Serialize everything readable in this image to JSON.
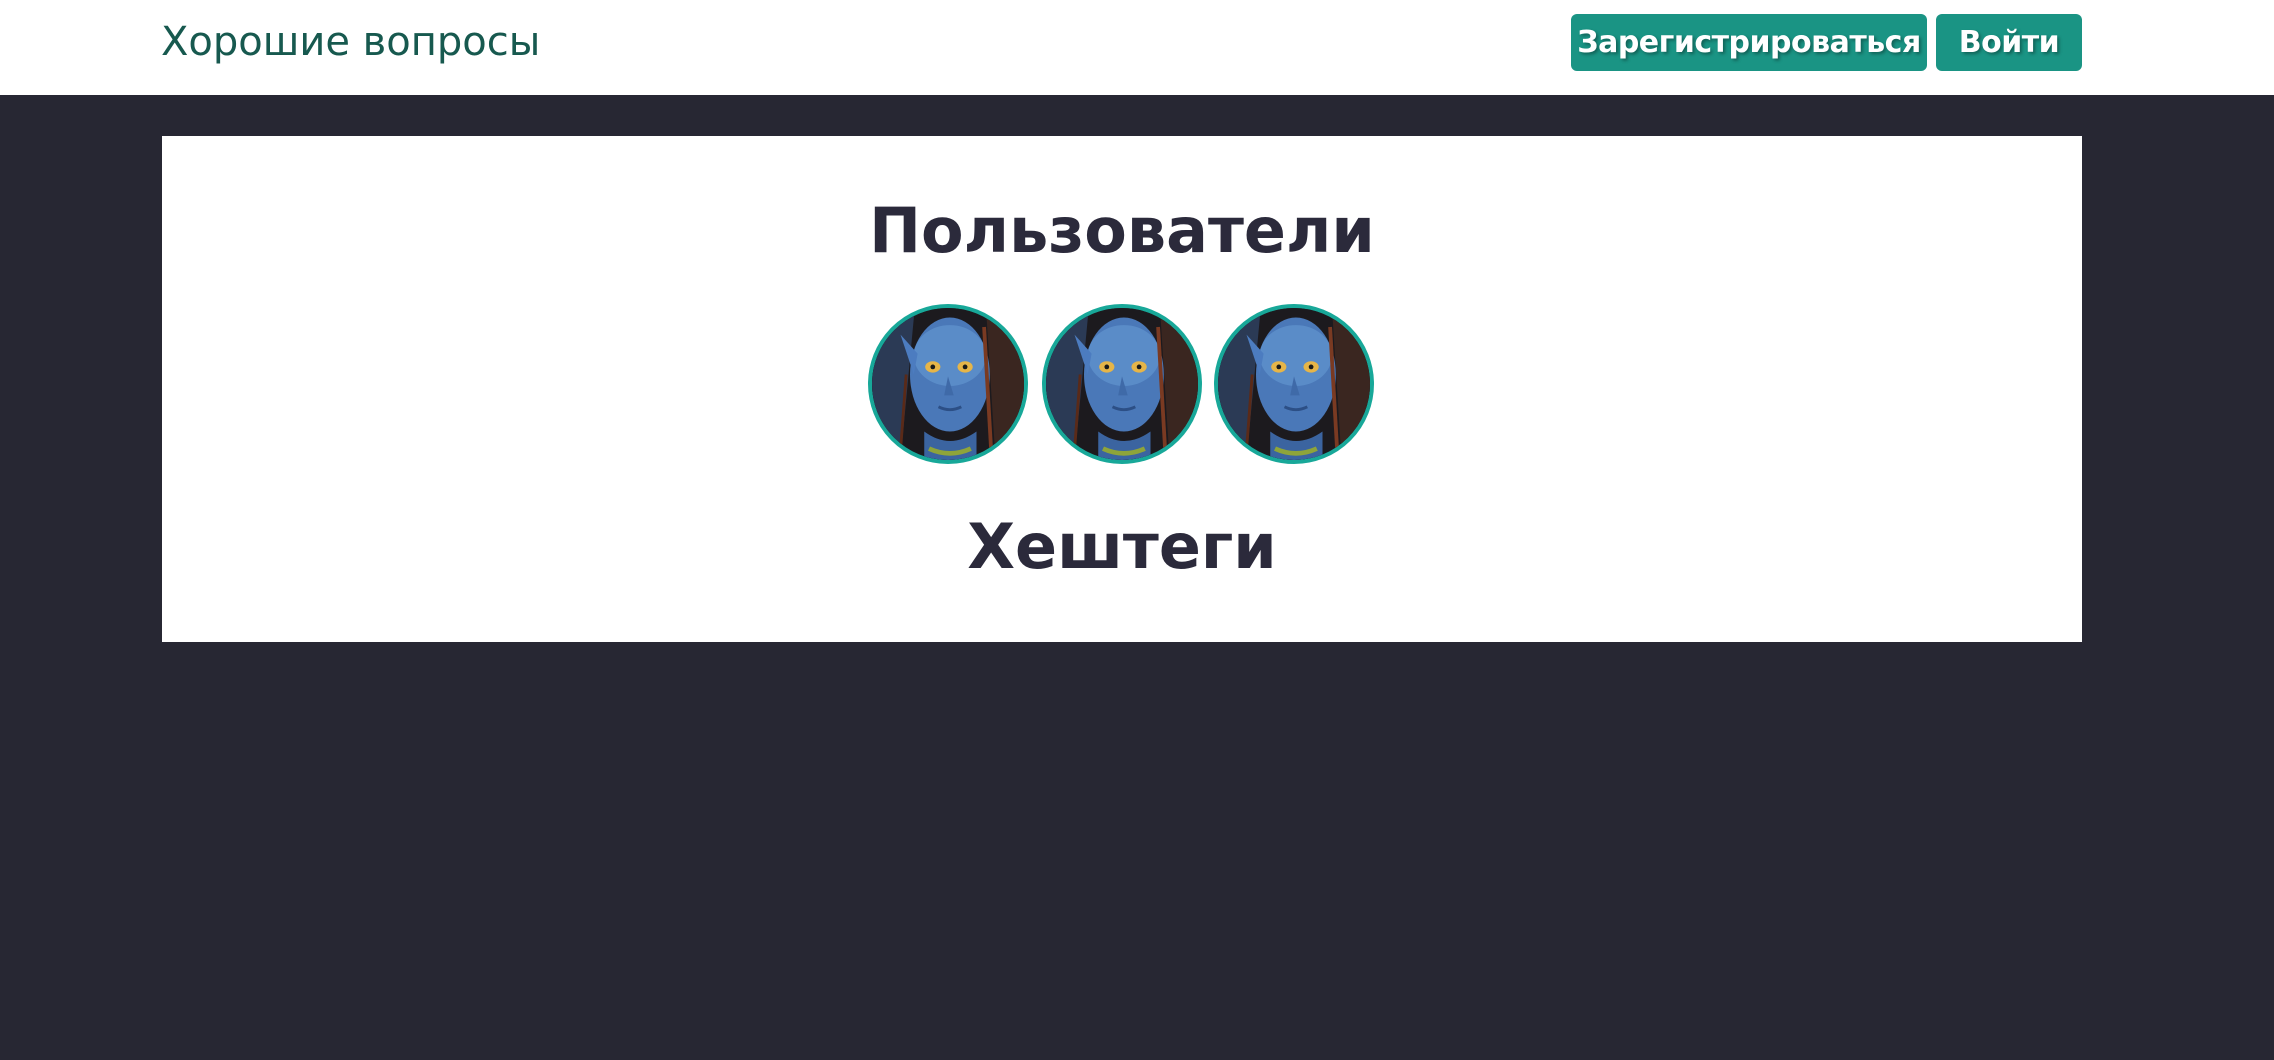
{
  "header": {
    "brand": "Хорошие вопросы",
    "register_label": "Зарегистрироваться",
    "login_label": "Войти"
  },
  "main": {
    "users_title": "Пользователи",
    "tags_title": "Хештеги",
    "users": [
      {
        "avatar_icon": "avatar-image"
      },
      {
        "avatar_icon": "avatar-image"
      },
      {
        "avatar_icon": "avatar-image"
      }
    ]
  },
  "colors": {
    "page_background": "#272733",
    "brand_text": "#17594f",
    "button_background": "#1a9484",
    "avatar_border": "#18a899",
    "heading_text": "#2b2a3b"
  }
}
